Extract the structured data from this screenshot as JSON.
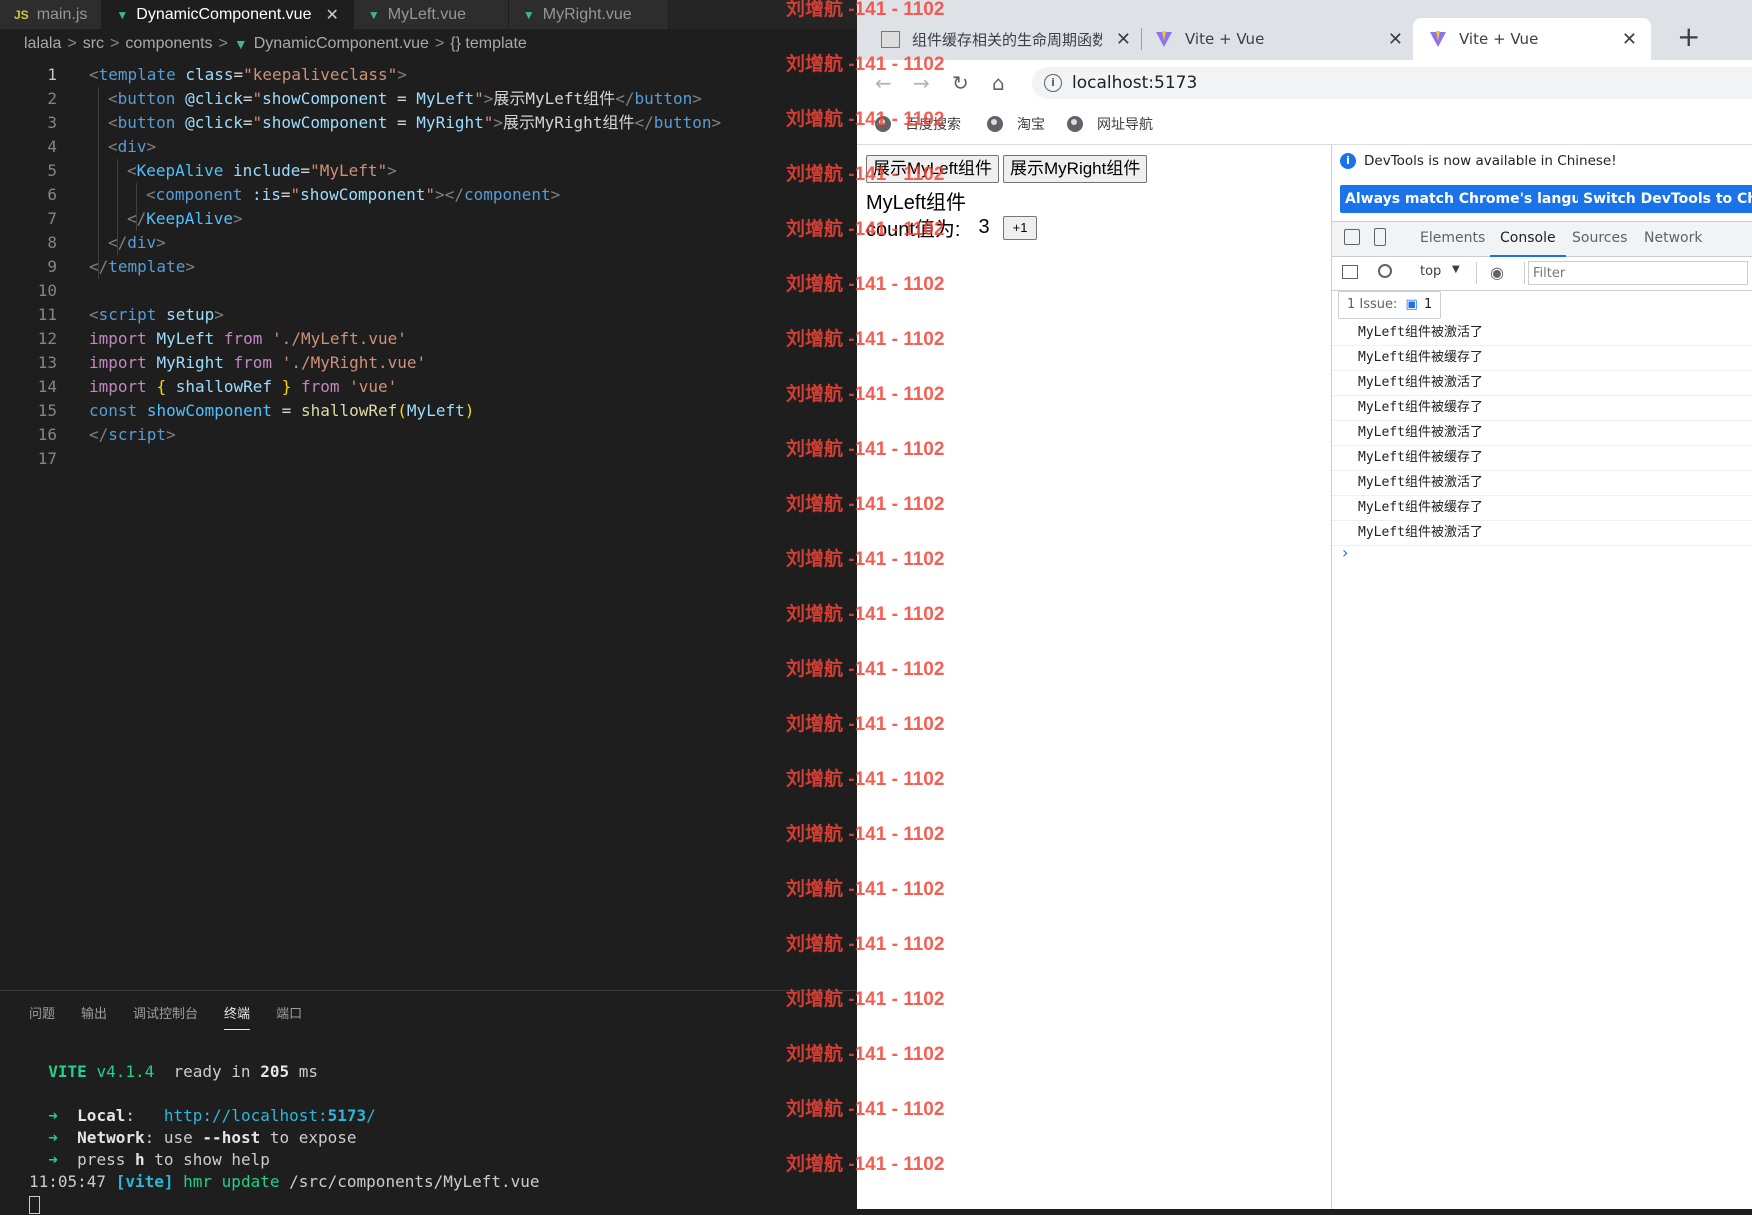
{
  "editor": {
    "tabs": [
      {
        "label": "main.js",
        "icon": "js-file-icon",
        "active": false
      },
      {
        "label": "DynamicComponent.vue",
        "icon": "vue-file-icon",
        "active": true
      },
      {
        "label": "MyLeft.vue",
        "icon": "vue-file-icon",
        "active": false
      },
      {
        "label": "MyRight.vue",
        "icon": "vue-file-icon",
        "active": false
      }
    ],
    "tab_js_badge": "JS",
    "close_glyph": "✕",
    "breadcrumb": [
      "lalala",
      "src",
      "components",
      "DynamicComponent.vue",
      "{} template"
    ],
    "breadcrumb_sep": ">",
    "line_numbers": [
      "1",
      "2",
      "3",
      "4",
      "5",
      "6",
      "7",
      "8",
      "9",
      "10",
      "11",
      "12",
      "13",
      "14",
      "15",
      "16",
      "17"
    ],
    "code": {
      "l1": [
        "<",
        "template",
        " ",
        "class",
        "=",
        "\"keepaliveclass\"",
        ">"
      ],
      "l2": [
        "<",
        "button",
        " ",
        "@click",
        "=",
        "\"",
        "showComponent",
        " = ",
        "MyLeft",
        "\"",
        ">",
        "展示MyLeft组件",
        "</",
        "button",
        ">"
      ],
      "l3": [
        "<",
        "button",
        " ",
        "@click",
        "=",
        "\"",
        "showComponent",
        " = ",
        "MyRight",
        "\"",
        ">",
        "展示MyRight组件",
        "</",
        "button",
        ">"
      ],
      "l4": [
        "<",
        "div",
        ">"
      ],
      "l5": [
        "<",
        "KeepAlive",
        " ",
        "include",
        "=",
        "\"MyLeft\"",
        ">"
      ],
      "l6": [
        "<",
        "component",
        " ",
        ":is",
        "=",
        "\"",
        "showComponent",
        "\"",
        "></",
        "component",
        ">"
      ],
      "l7": [
        "</",
        "KeepAlive",
        ">"
      ],
      "l8": [
        "</",
        "div",
        ">"
      ],
      "l9": [
        "</",
        "template",
        ">"
      ],
      "l11": [
        "<",
        "script",
        " ",
        "setup",
        ">"
      ],
      "l12": [
        "import",
        " ",
        "MyLeft",
        " ",
        "from",
        " ",
        "'./MyLeft.vue'"
      ],
      "l13": [
        "import",
        " ",
        "MyRight",
        " ",
        "from",
        " ",
        "'./MyRight.vue'"
      ],
      "l14": [
        "import",
        " ",
        "{",
        " ",
        "shallowRef",
        " ",
        "}",
        " ",
        "from",
        " ",
        "'vue'"
      ],
      "l15": [
        "const",
        " ",
        "showComponent",
        " = ",
        "shallowRef",
        "(",
        "MyLeft",
        ")"
      ],
      "l16": [
        "</",
        "script",
        ">"
      ]
    },
    "panel_tabs": [
      "问题",
      "输出",
      "调试控制台",
      "终端",
      "端口"
    ],
    "panel_active": "终端",
    "terminal": {
      "vite": "VITE",
      "version": "v4.1.4",
      "ready": "ready in",
      "ms_value": "205",
      "ms_unit": "ms",
      "arrow": "➜",
      "local_label": "Local",
      "local_url_base": "http://localhost:",
      "local_url_port": "5173",
      "local_url_tail": "/",
      "network_label": "Network",
      "network_text_1": "use",
      "network_flag": "--host",
      "network_text_2": "to expose",
      "help_text_1": "press",
      "help_key": "h",
      "help_text_2": "to show help",
      "time": "11:05:47",
      "tag": "[vite]",
      "hmr": "hmr update",
      "path": "/src/components/MyLeft.vue"
    }
  },
  "browser": {
    "tabs": [
      {
        "label": "组件缓存相关的生命周期函数",
        "active": false
      },
      {
        "label": "Vite + Vue",
        "active": false
      },
      {
        "label": "Vite + Vue",
        "active": true
      }
    ],
    "new_tab": "+",
    "close_glyph": "✕",
    "url": "localhost:5173",
    "bookmarks": [
      "百度搜索",
      "淘宝",
      "网址导航"
    ],
    "page": {
      "btn_left": "展示MyLeft组件",
      "btn_right": "展示MyRight组件",
      "title": "MyLeft组件",
      "count_label": "count值为:",
      "count_value": "3",
      "inc_label": "+1"
    },
    "devtools": {
      "notice": "DevTools is now available in Chinese!",
      "btn_match": "Always match Chrome's language",
      "btn_switch": "Switch DevTools to Chin",
      "tabs": [
        "Elements",
        "Console",
        "Sources",
        "Network"
      ],
      "active_tab": "Console",
      "context": "top",
      "filter_placeholder": "Filter",
      "issues_label": "1 Issue:",
      "issues_count": "1",
      "logs": [
        "MyLeft组件被激活了",
        "MyLeft组件被缓存了",
        "MyLeft组件被激活了",
        "MyLeft组件被缓存了",
        "MyLeft组件被激活了",
        "MyLeft组件被缓存了",
        "MyLeft组件被激活了",
        "MyLeft组件被缓存了",
        "MyLeft组件被激活了"
      ],
      "prompt": "›"
    }
  },
  "watermark": {
    "text": "刘增航 -141 - 1102",
    "count": 22
  }
}
